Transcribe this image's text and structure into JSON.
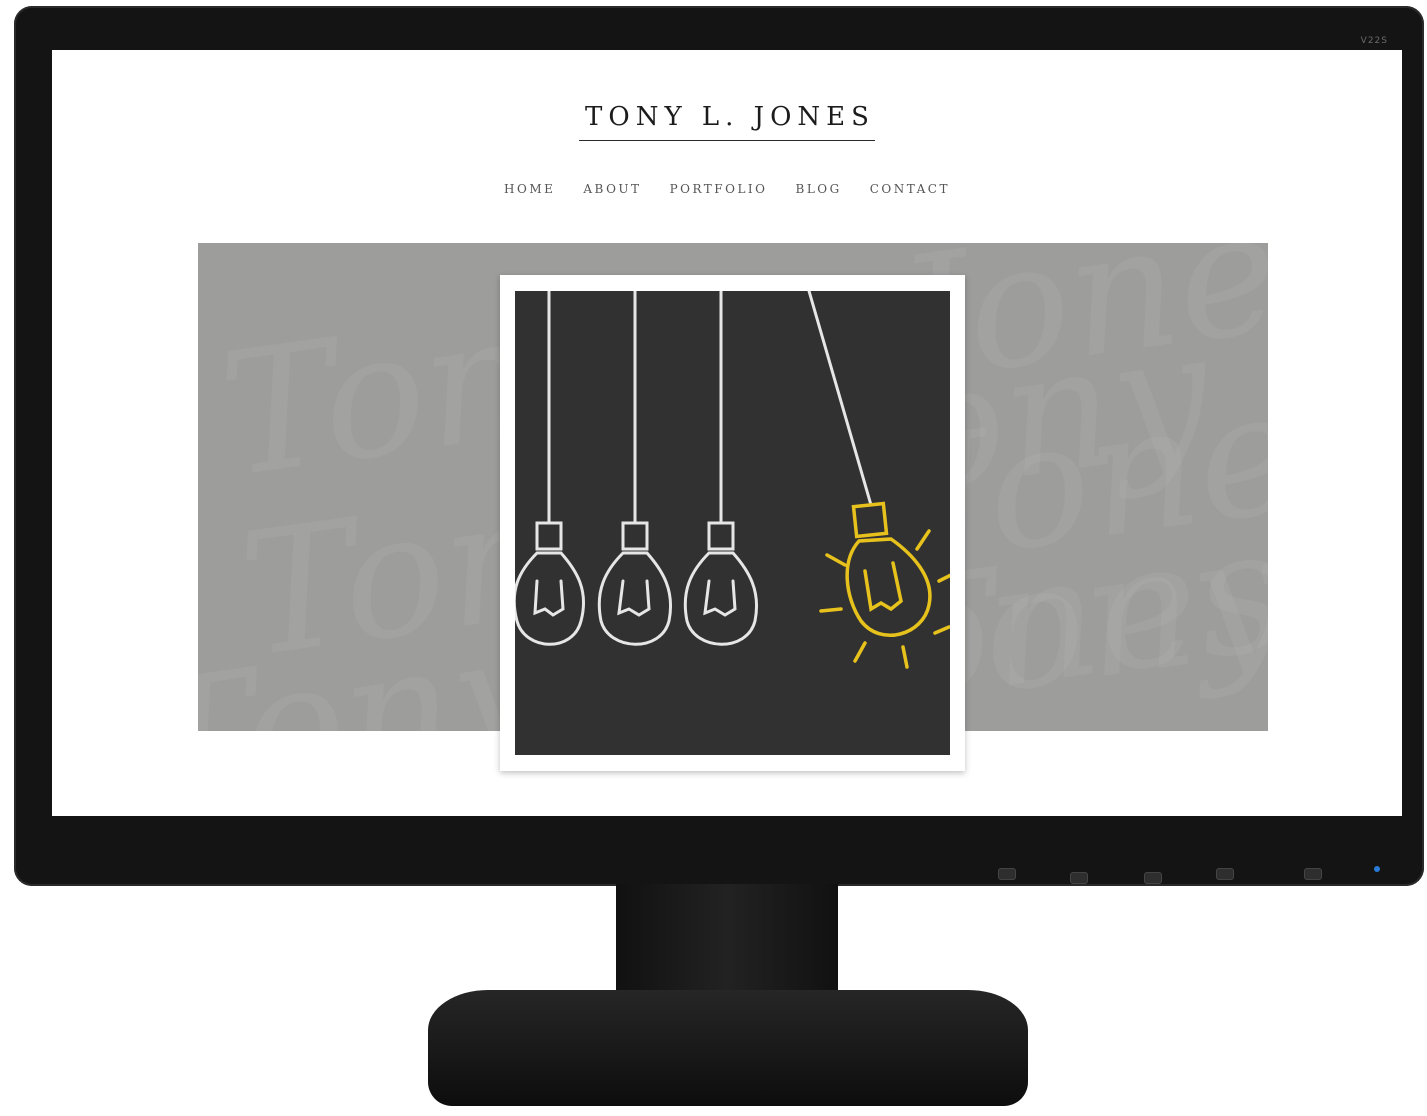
{
  "site": {
    "title": "TONY L. JONES",
    "nav": [
      "HOME",
      "ABOUT",
      "PORTFOLIO",
      "BLOG",
      "CONTACT"
    ]
  },
  "hero": {
    "background_color": "#9d9e9c",
    "watermark_text": "Tony L. Jones",
    "image_icon": "lightbulbs-chalkboard-icon"
  },
  "monitor": {
    "model_label": "V22S",
    "power_led_color": "#2a7bd8"
  },
  "colors": {
    "chalk_white": "#e6e6e6",
    "bulb_yellow": "#e8c21c",
    "chalkboard": "#313131"
  }
}
